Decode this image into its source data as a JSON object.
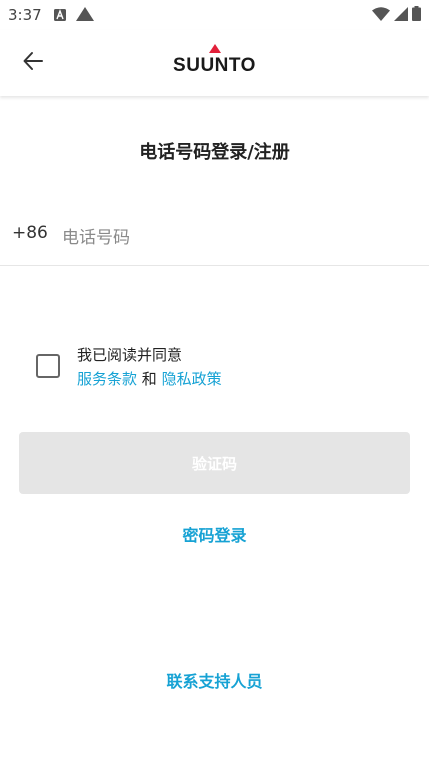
{
  "status_bar": {
    "time": "3:37",
    "left_icons": [
      "notification-a-icon",
      "warning-triangle-icon"
    ],
    "right_icons": [
      "wifi-icon",
      "cellular-signal-icon",
      "battery-icon"
    ]
  },
  "app_bar": {
    "brand": "SUUNTO",
    "back_icon": "arrow-left-icon"
  },
  "title": "电话号码登录/注册",
  "phone": {
    "country_code": "+86",
    "placeholder": "电话号码",
    "value": ""
  },
  "agreement": {
    "line1": "我已阅读并同意",
    "terms_link": "服务条款",
    "conjunction": "和",
    "privacy_link": "隐私政策",
    "checked": false
  },
  "code_button_label": "验证码",
  "password_login_label": "密码登录",
  "contact_support_label": "联系支持人员",
  "colors": {
    "accent": "#16a2d4",
    "logo_red": "#e2203a",
    "disabled_button": "#e5e5e5"
  }
}
